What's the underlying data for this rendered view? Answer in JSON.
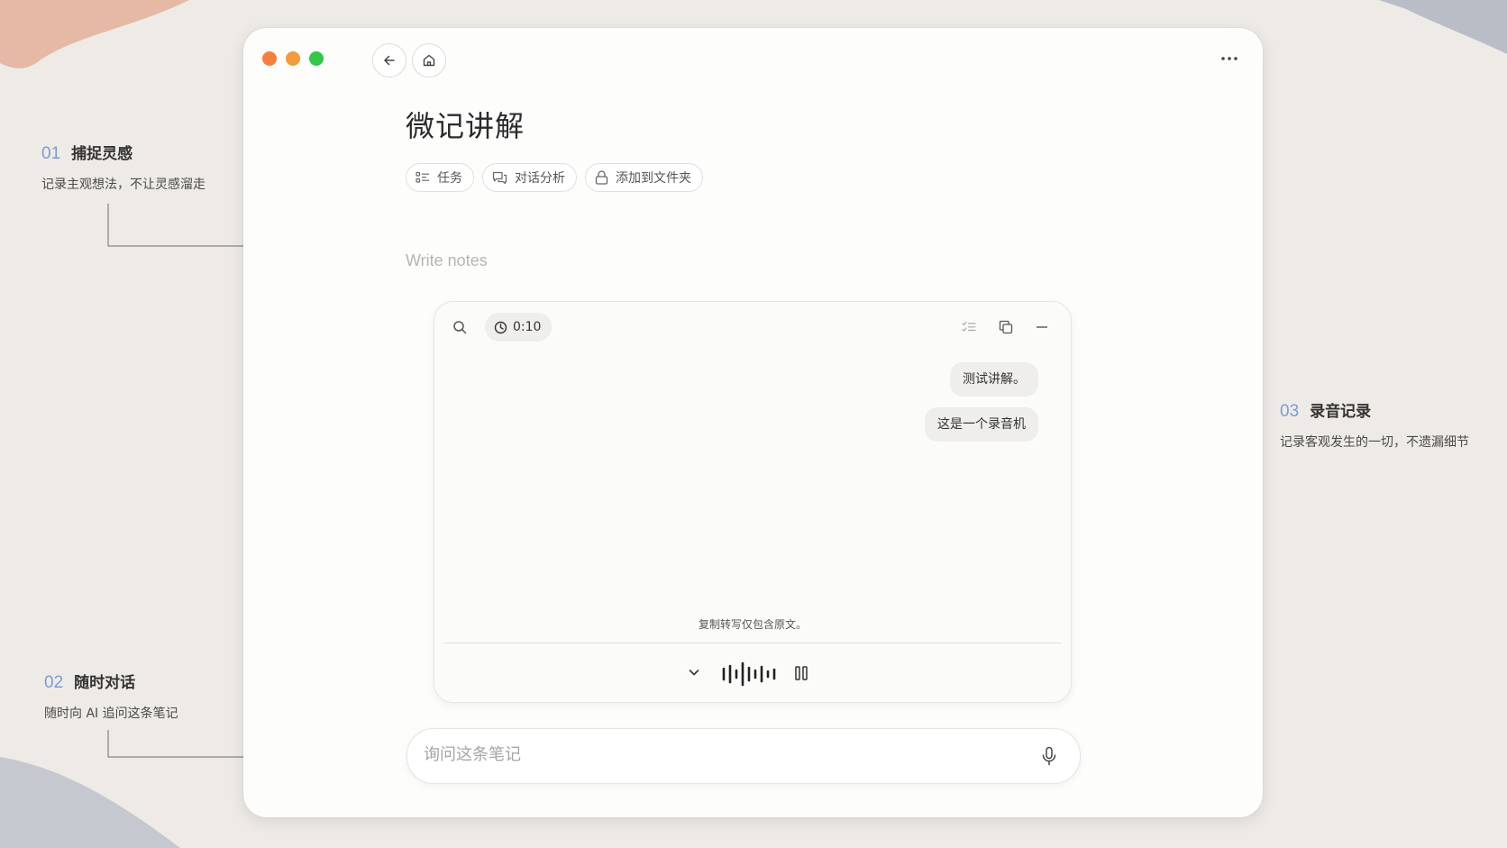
{
  "annotations": [
    {
      "num": "01",
      "title": "捕捉灵感",
      "desc": "记录主观想法，不让灵感溜走"
    },
    {
      "num": "02",
      "title": "随时对话",
      "desc": "随时向 AI 追问这条笔记"
    },
    {
      "num": "03",
      "title": "录音记录",
      "desc": "记录客观发生的一切，不遗漏细节"
    }
  ],
  "window": {
    "traffic_lights": [
      "#f57f3c",
      "#f59a3c",
      "#32c748"
    ],
    "title": "微记讲解",
    "chips": [
      {
        "label": "任务",
        "icon": "task-list-icon"
      },
      {
        "label": "对话分析",
        "icon": "chat-icon"
      },
      {
        "label": "添加到文件夹",
        "icon": "lock-icon"
      }
    ],
    "notes_placeholder": "Write notes"
  },
  "recorder": {
    "timer": "0:10",
    "messages": [
      "测试讲解。",
      "这是一个录音机"
    ],
    "copy_note": "复制转写仅包含原文。"
  },
  "ask": {
    "placeholder": "询问这条笔记"
  },
  "colors": {
    "accent": "#7b9bd6",
    "background": "#eeebe6",
    "window": "#fdfdfc"
  }
}
